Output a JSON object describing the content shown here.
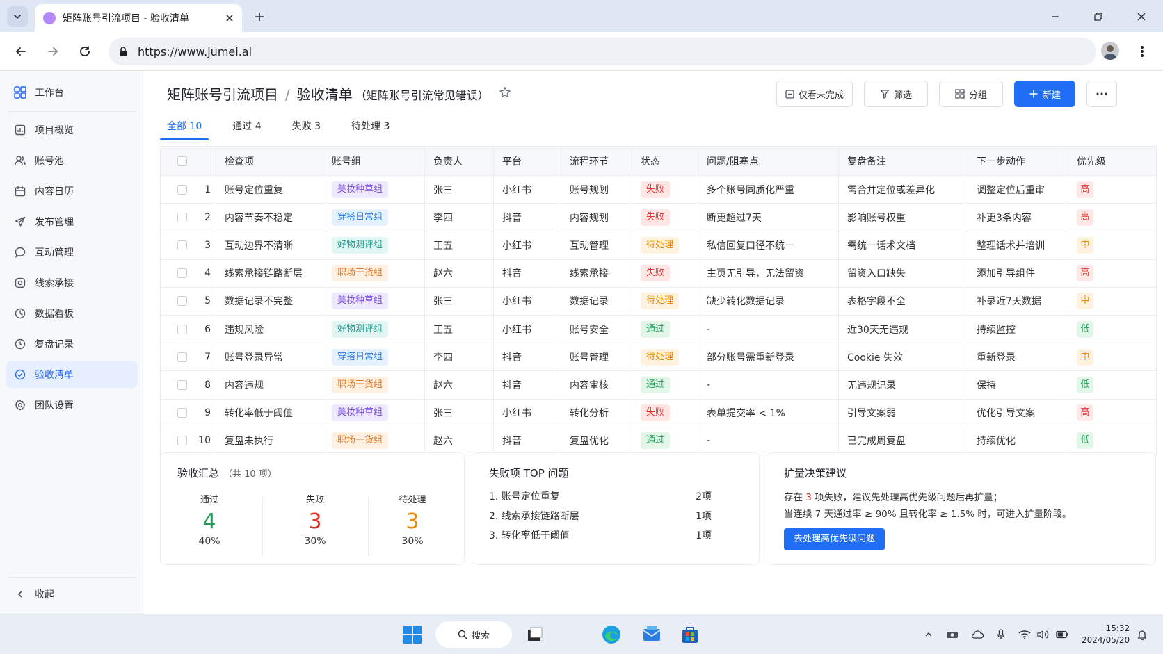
{
  "browser": {
    "tab_title": "矩阵账号引流项目 - 验收清单",
    "url": "https://www.jumei.ai"
  },
  "sidebar": {
    "items": [
      {
        "label": "工作台",
        "icon": "grid-icon"
      },
      {
        "label": "项目概览",
        "icon": "overview-icon"
      },
      {
        "label": "账号池",
        "icon": "users-icon"
      },
      {
        "label": "内容日历",
        "icon": "calendar-icon"
      },
      {
        "label": "发布管理",
        "icon": "send-icon"
      },
      {
        "label": "互动管理",
        "icon": "chat-icon"
      },
      {
        "label": "线索承接",
        "icon": "target-icon"
      },
      {
        "label": "数据看板",
        "icon": "dashboard-icon"
      },
      {
        "label": "复盘记录",
        "icon": "history-icon"
      },
      {
        "label": "验收清单",
        "icon": "check-circle-icon"
      },
      {
        "label": "团队设置",
        "icon": "settings-icon"
      }
    ],
    "collapse_label": "收起"
  },
  "header": {
    "project": "矩阵账号引流项目",
    "separator": "/",
    "title": "验收清单",
    "subtitle": "（矩阵账号引流常见错误）"
  },
  "toolbar": {
    "only_unfinished": "仅看未完成",
    "filter": "筛选",
    "group": "分组",
    "new": "新建"
  },
  "filter_tabs": [
    {
      "label": "全部",
      "count": "10"
    },
    {
      "label": "通过",
      "count": "4"
    },
    {
      "label": "失败",
      "count": "3"
    },
    {
      "label": "待处理",
      "count": "3"
    }
  ],
  "table": {
    "columns": [
      "检查项",
      "账号组",
      "负责人",
      "平台",
      "流程环节",
      "状态",
      "问题/阻塞点",
      "复盘备注",
      "下一步动作",
      "优先级"
    ],
    "rows": [
      {
        "no": "1",
        "item": "账号定位重复",
        "group": "美妆种草组",
        "owner": "张三",
        "platform": "小红书",
        "stage": "账号规划",
        "status": "失败",
        "issue": "多个账号同质化严重",
        "note": "需合并定位或差异化",
        "next": "调整定位后重审",
        "priority": "高"
      },
      {
        "no": "2",
        "item": "内容节奏不稳定",
        "group": "穿搭日常组",
        "owner": "李四",
        "platform": "抖音",
        "stage": "内容规划",
        "status": "失败",
        "issue": "断更超过7天",
        "note": "影响账号权重",
        "next": "补更3条内容",
        "priority": "高"
      },
      {
        "no": "3",
        "item": "互动边界不清晰",
        "group": "好物测评组",
        "owner": "王五",
        "platform": "小红书",
        "stage": "互动管理",
        "status": "待处理",
        "issue": "私信回复口径不统一",
        "note": "需统一话术文档",
        "next": "整理话术并培训",
        "priority": "中"
      },
      {
        "no": "4",
        "item": "线索承接链路断层",
        "group": "职场干货组",
        "owner": "赵六",
        "platform": "抖音",
        "stage": "线索承接",
        "status": "失败",
        "issue": "主页无引导，无法留资",
        "note": "留资入口缺失",
        "next": "添加引导组件",
        "priority": "高"
      },
      {
        "no": "5",
        "item": "数据记录不完整",
        "group": "美妆种草组",
        "owner": "张三",
        "platform": "小红书",
        "stage": "数据记录",
        "status": "待处理",
        "issue": "缺少转化数据记录",
        "note": "表格字段不全",
        "next": "补录近7天数据",
        "priority": "中"
      },
      {
        "no": "6",
        "item": "违规风险",
        "group": "好物测评组",
        "owner": "王五",
        "platform": "小红书",
        "stage": "账号安全",
        "status": "通过",
        "issue": "-",
        "note": "近30天无违规",
        "next": "持续监控",
        "priority": "低"
      },
      {
        "no": "7",
        "item": "账号登录异常",
        "group": "穿搭日常组",
        "owner": "李四",
        "platform": "抖音",
        "stage": "账号管理",
        "status": "待处理",
        "issue": "部分账号需重新登录",
        "note": "Cookie 失效",
        "next": "重新登录",
        "priority": "中"
      },
      {
        "no": "8",
        "item": "内容违规",
        "group": "职场干货组",
        "owner": "赵六",
        "platform": "抖音",
        "stage": "内容审核",
        "status": "通过",
        "issue": "-",
        "note": "无违规记录",
        "next": "保持",
        "priority": "低"
      },
      {
        "no": "9",
        "item": "转化率低于阈值",
        "group": "美妆种草组",
        "owner": "张三",
        "platform": "小红书",
        "stage": "转化分析",
        "status": "失败",
        "issue": "表单提交率 < 1%",
        "note": "引导文案弱",
        "next": "优化引导文案",
        "priority": "高"
      },
      {
        "no": "10",
        "item": "复盘未执行",
        "group": "职场干货组",
        "owner": "赵六",
        "platform": "抖音",
        "stage": "复盘优化",
        "status": "通过",
        "issue": "-",
        "note": "已完成周复盘",
        "next": "持续优化",
        "priority": "低"
      }
    ]
  },
  "summary": {
    "title": "验收汇总",
    "subtitle": "（共 10 项）",
    "stats": [
      {
        "label": "通过",
        "value": "4",
        "pct": "40%",
        "color": "#1f9d55"
      },
      {
        "label": "失败",
        "value": "3",
        "pct": "30%",
        "color": "#e5322d"
      },
      {
        "label": "待处理",
        "value": "3",
        "pct": "30%",
        "color": "#ef8a00"
      }
    ]
  },
  "top_issues": {
    "title": "失败项 TOP 问题",
    "items": [
      {
        "label": "1.  账号定位重复",
        "count": "2项"
      },
      {
        "label": "2.  线索承接链路断层",
        "count": "1项"
      },
      {
        "label": "3.  转化率低于阈值",
        "count": "1项"
      }
    ]
  },
  "advice": {
    "title": "扩量决策建议",
    "line1_pre": "存在 ",
    "line1_num": "3",
    "line1_post": " 项失败，建议先处理高优先级问题后再扩量；",
    "line2": "当连续 7 天通过率 ≥ 90% 且转化率 ≥ 1.5% 时，可进入扩量阶段。",
    "button": "去处理高优先级问题"
  },
  "taskbar": {
    "search": "搜索",
    "time": "15:32",
    "date": "2024/05/20"
  },
  "colors": {
    "primary": "#1f6ef5",
    "fail": "#e5322d",
    "pass": "#23a057",
    "pending": "#ed8a00"
  }
}
